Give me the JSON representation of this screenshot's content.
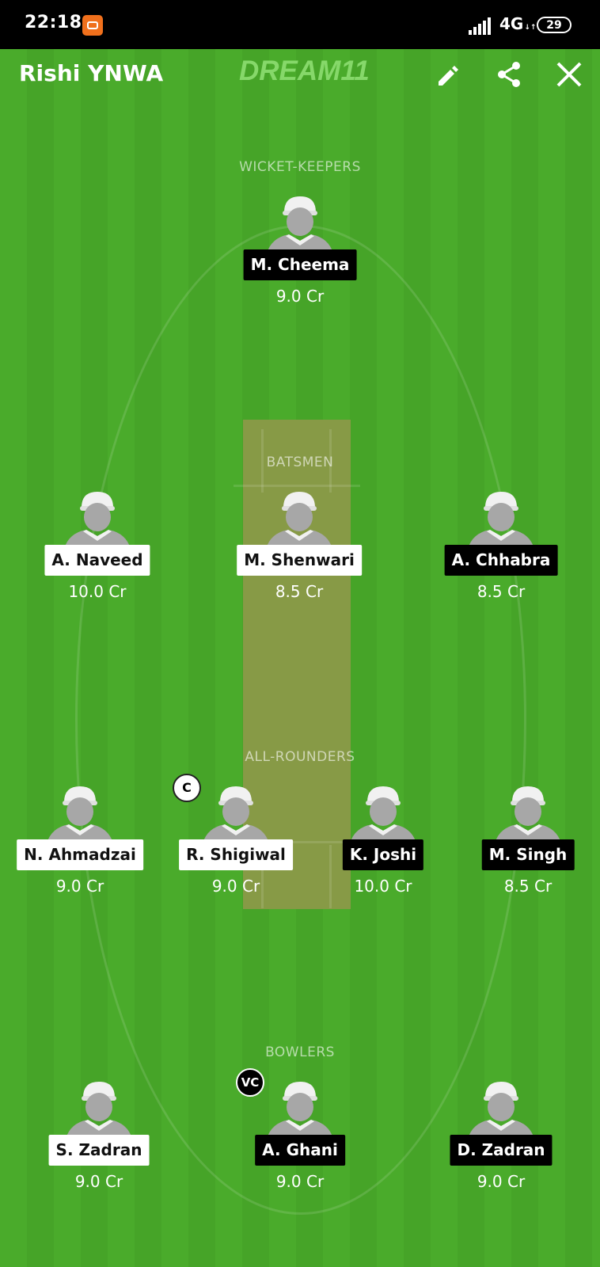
{
  "status_bar": {
    "time": "22:18",
    "network": "4G",
    "battery": "29"
  },
  "header": {
    "team_name": "Rishi YNWA",
    "logo": "DREAM11"
  },
  "icons": {
    "edit": "pencil-icon",
    "share": "share-icon",
    "close": "close-icon"
  },
  "colors": {
    "field": "#4aab2b",
    "pitch": "#879a46",
    "logo": "#86d86a"
  },
  "sections": {
    "wicket_keepers": "WICKET-KEEPERS",
    "batsmen": "BATSMEN",
    "all_rounders": "ALL-ROUNDERS",
    "bowlers": "BOWLERS"
  },
  "wicket_keepers": [
    {
      "name": "M. Cheema",
      "credit": "9.0 Cr",
      "style": "black"
    }
  ],
  "batsmen": [
    {
      "name": "A. Naveed",
      "credit": "10.0 Cr",
      "style": "white"
    },
    {
      "name": "M. Shenwari",
      "credit": "8.5 Cr",
      "style": "white"
    },
    {
      "name": "A. Chhabra",
      "credit": "8.5 Cr",
      "style": "black"
    }
  ],
  "all_rounders": [
    {
      "name": "N. Ahmadzai",
      "credit": "9.0 Cr",
      "style": "white"
    },
    {
      "name": "R. Shigiwal",
      "credit": "9.0 Cr",
      "style": "white",
      "badge": "C"
    },
    {
      "name": "K. Joshi",
      "credit": "10.0 Cr",
      "style": "black"
    },
    {
      "name": "M. Singh",
      "credit": "8.5 Cr",
      "style": "black"
    }
  ],
  "bowlers": [
    {
      "name": "S. Zadran",
      "credit": "9.0 Cr",
      "style": "white"
    },
    {
      "name": "A. Ghani",
      "credit": "9.0 Cr",
      "style": "black",
      "badge": "VC"
    },
    {
      "name": "D. Zadran",
      "credit": "9.0 Cr",
      "style": "black"
    }
  ]
}
